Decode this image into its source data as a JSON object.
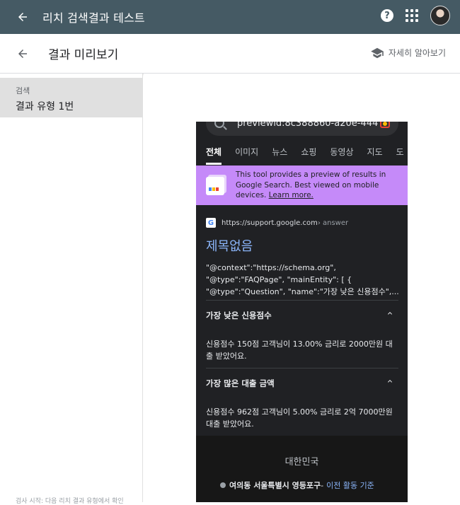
{
  "app": {
    "title": "리치 검색결과 테스트",
    "help_symbol": "?"
  },
  "subheader": {
    "title": "결과 미리보기",
    "learn_more": "자세히 알아보기"
  },
  "sidebar": {
    "category": "검색",
    "item": "결과 유형 1번",
    "footer_text": "검사 시작: 다음 리치 결과 유형에서 확인"
  },
  "preview": {
    "search_query": "previewid:8c388860-a20e-444e-",
    "tabs": [
      "전체",
      "이미지",
      "뉴스",
      "쇼핑",
      "동영상",
      "지도",
      "도"
    ],
    "active_tab": "전체",
    "banner_text": "This tool provides a preview of results in Google Search. Best viewed on mobile devices.",
    "banner_link": "Learn more.",
    "result": {
      "favicon": "G",
      "url": "https://support.google.com",
      "breadcrumb": " › answer",
      "title": "제목없음",
      "snippet_lines": [
        "\"@context\":\"https://schema.org\",",
        "\"@type\":\"FAQPage\", \"mainEntity\": [ {",
        "\"@type\":\"Question\", \"name\":\"가장 낮은 신용점수\",..."
      ]
    },
    "faq": [
      {
        "question": "가장 낮은 신용점수",
        "answer_lines": [
          "신용점수 150점 고객님이 13.00% 금리로 2000만원 대",
          "출 받았어요."
        ]
      },
      {
        "question": "가장 많은 대출 금액",
        "answer_lines": [
          "신용점수 962점 고객님이 5.00% 금리로 2억 7000만원",
          "대출 받았어요."
        ]
      }
    ],
    "footer": {
      "country": "대한민국",
      "location": "여의동 서울특별시 영등포구",
      "separator": " - ",
      "link": "이전 활동 기준"
    }
  },
  "colors": {
    "topbar": "#455a64",
    "banner": "#c58af9",
    "phone_bg": "#202124",
    "link": "#8ab4f8"
  }
}
